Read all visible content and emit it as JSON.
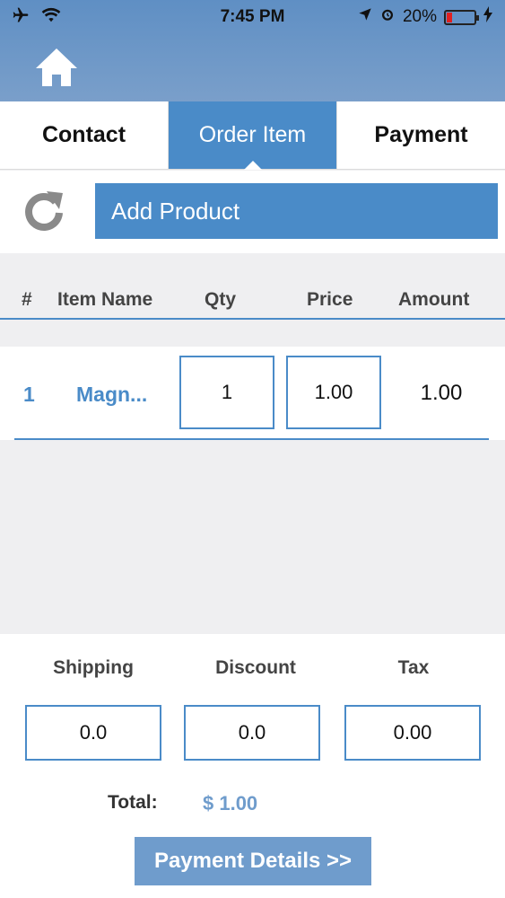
{
  "status_bar": {
    "time": "7:45 PM",
    "battery_percent": "20%",
    "battery_level": 0.2
  },
  "icons": {
    "home": "home-icon",
    "refresh": "refresh-icon",
    "airplane": "airplane-icon",
    "wifi": "wifi-icon",
    "location": "location-arrow-icon",
    "alarm": "alarm-icon",
    "battery": "battery-icon",
    "charging": "charging-bolt-icon"
  },
  "tabs": [
    {
      "label": "Contact",
      "active": false
    },
    {
      "label": "Order Item",
      "active": true
    },
    {
      "label": "Payment",
      "active": false
    }
  ],
  "add_product_label": "Add Product",
  "table": {
    "headers": {
      "num": "#",
      "name": "Item Name",
      "qty": "Qty",
      "price": "Price",
      "amount": "Amount"
    },
    "rows": [
      {
        "num": "1",
        "name": "Magn...",
        "qty": "1",
        "price": "1.00",
        "amount": "1.00"
      }
    ]
  },
  "summary": {
    "shipping_label": "Shipping",
    "discount_label": "Discount",
    "tax_label": "Tax",
    "shipping_value": "0.0",
    "discount_value": "0.0",
    "tax_value": "0.00",
    "total_label": "Total:",
    "total_value": "$ 1.00"
  },
  "payment_details_label": "Payment Details >>",
  "colors": {
    "accent": "#4a8bc8",
    "header_bar": "#6f9ccc",
    "battery_low": "#e02020"
  }
}
